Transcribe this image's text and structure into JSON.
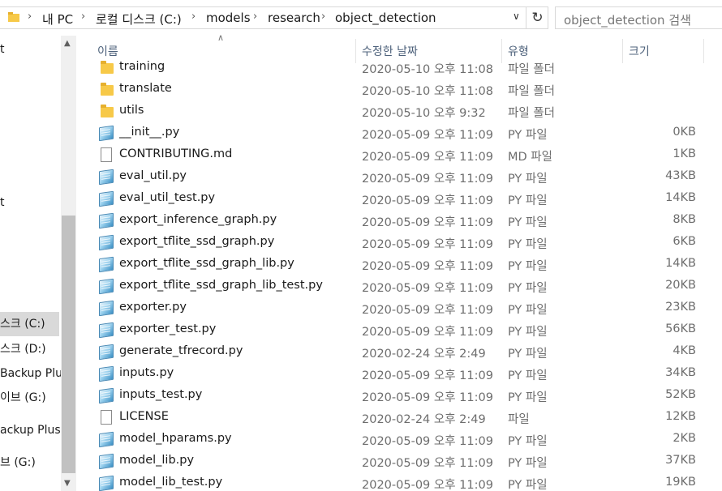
{
  "address": {
    "breadcrumbs": [
      "내 PC",
      "로컬 디스크 (C:)",
      "models",
      "research",
      "object_detection"
    ],
    "search_placeholder": "object_detection 검색"
  },
  "nav": {
    "items": [
      {
        "label": "t"
      },
      {
        "label": "t"
      },
      {
        "label": "스크 (C:)",
        "selected": true
      },
      {
        "label": "스크 (D:)"
      },
      {
        "label": "Backup Plus"
      },
      {
        "label": "이브 (G:)"
      },
      {
        "label": "ackup Plus"
      },
      {
        "label": "브 (G:)"
      }
    ]
  },
  "columns": {
    "name": "이름",
    "date": "수정한 날짜",
    "type": "유형",
    "size": "크기"
  },
  "files": [
    {
      "name": "training",
      "date": "2020-05-10 오후 11:08",
      "type": "파일 폴더",
      "size": "",
      "icon": "folder-icon"
    },
    {
      "name": "translate",
      "date": "2020-05-10 오후 11:08",
      "type": "파일 폴더",
      "size": "",
      "icon": "folder-icon"
    },
    {
      "name": "utils",
      "date": "2020-05-10 오후 9:32",
      "type": "파일 폴더",
      "size": "",
      "icon": "folder-icon"
    },
    {
      "name": "__init__.py",
      "date": "2020-05-09 오후 11:09",
      "type": "PY 파일",
      "size": "0KB",
      "icon": "python-file-icon"
    },
    {
      "name": "CONTRIBUTING.md",
      "date": "2020-05-09 오후 11:09",
      "type": "MD 파일",
      "size": "1KB",
      "icon": "file-icon"
    },
    {
      "name": "eval_util.py",
      "date": "2020-05-09 오후 11:09",
      "type": "PY 파일",
      "size": "43KB",
      "icon": "python-file-icon"
    },
    {
      "name": "eval_util_test.py",
      "date": "2020-05-09 오후 11:09",
      "type": "PY 파일",
      "size": "14KB",
      "icon": "python-file-icon"
    },
    {
      "name": "export_inference_graph.py",
      "date": "2020-05-09 오후 11:09",
      "type": "PY 파일",
      "size": "8KB",
      "icon": "python-file-icon"
    },
    {
      "name": "export_tflite_ssd_graph.py",
      "date": "2020-05-09 오후 11:09",
      "type": "PY 파일",
      "size": "6KB",
      "icon": "python-file-icon"
    },
    {
      "name": "export_tflite_ssd_graph_lib.py",
      "date": "2020-05-09 오후 11:09",
      "type": "PY 파일",
      "size": "14KB",
      "icon": "python-file-icon"
    },
    {
      "name": "export_tflite_ssd_graph_lib_test.py",
      "date": "2020-05-09 오후 11:09",
      "type": "PY 파일",
      "size": "20KB",
      "icon": "python-file-icon"
    },
    {
      "name": "exporter.py",
      "date": "2020-05-09 오후 11:09",
      "type": "PY 파일",
      "size": "23KB",
      "icon": "python-file-icon"
    },
    {
      "name": "exporter_test.py",
      "date": "2020-05-09 오후 11:09",
      "type": "PY 파일",
      "size": "56KB",
      "icon": "python-file-icon"
    },
    {
      "name": "generate_tfrecord.py",
      "date": "2020-02-24 오후 2:49",
      "type": "PY 파일",
      "size": "4KB",
      "icon": "python-file-icon"
    },
    {
      "name": "inputs.py",
      "date": "2020-05-09 오후 11:09",
      "type": "PY 파일",
      "size": "34KB",
      "icon": "python-file-icon"
    },
    {
      "name": "inputs_test.py",
      "date": "2020-05-09 오후 11:09",
      "type": "PY 파일",
      "size": "52KB",
      "icon": "python-file-icon"
    },
    {
      "name": "LICENSE",
      "date": "2020-02-24 오후 2:49",
      "type": "파일",
      "size": "12KB",
      "icon": "file-icon"
    },
    {
      "name": "model_hparams.py",
      "date": "2020-05-09 오후 11:09",
      "type": "PY 파일",
      "size": "2KB",
      "icon": "python-file-icon"
    },
    {
      "name": "model_lib.py",
      "date": "2020-05-09 오후 11:09",
      "type": "PY 파일",
      "size": "37KB",
      "icon": "python-file-icon"
    },
    {
      "name": "model_lib_test.py",
      "date": "2020-05-09 오후 11:09",
      "type": "PY 파일",
      "size": "19KB",
      "icon": "python-file-icon"
    }
  ]
}
